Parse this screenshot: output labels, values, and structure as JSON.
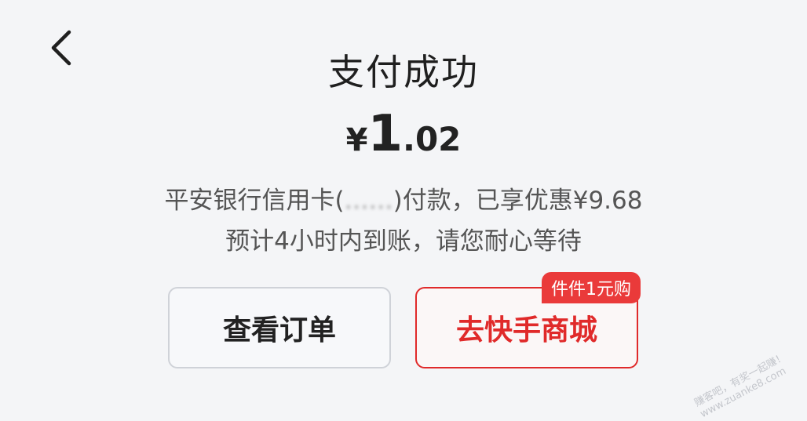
{
  "header": {
    "back_icon": "chevron-left-icon",
    "title": "支付成功"
  },
  "payment": {
    "currency": "¥",
    "amount_integer": "1",
    "amount_decimal": ".02",
    "method_prefix": "平安银行信用卡(",
    "method_masked": "……",
    "method_suffix": ")付款，已享优惠¥9.68",
    "eta": "预计4小时内到账，请您耐心等待"
  },
  "actions": {
    "view_order_label": "查看订单",
    "mall_label": "去快手商城",
    "mall_badge": "件件1元购"
  },
  "watermark": {
    "line1": "赚客吧，有奖一起赚！",
    "line2": "www.zuanke8.com"
  },
  "colors": {
    "accent": "#e02a2a",
    "badge": "#ea3a3a",
    "background": "#f4f5f7"
  }
}
